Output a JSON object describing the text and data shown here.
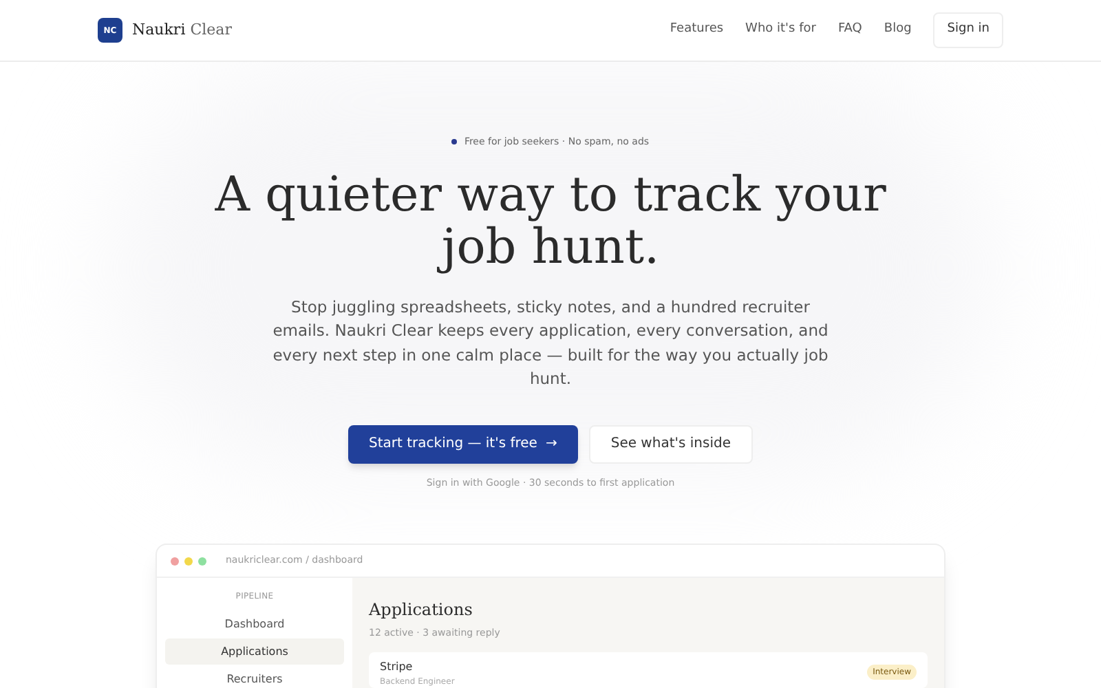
{
  "header": {
    "logo_mark": "NC",
    "brand": {
      "first": "Naukri",
      "second": "Clear"
    },
    "nav": [
      "Features",
      "Who it's for",
      "FAQ",
      "Blog"
    ],
    "sign_in": "Sign in"
  },
  "hero": {
    "badge": "Free for job seekers · No spam, no ads",
    "title": "A quieter way to track your job hunt.",
    "description": "Stop juggling spreadsheets, sticky notes, and a hundred recruiter emails. Naukri Clear keeps every application, every conversation, and every next step in one calm place — built for the way you actually job hunt.",
    "primary_button": "Start tracking — it's free",
    "primary_arrow": "→",
    "secondary_button": "See what's inside",
    "note": "Sign in with Google · 30 seconds to first application"
  },
  "preview": {
    "url": "naukriclear.com / dashboard",
    "sidebar": {
      "section": "PIPELINE",
      "items": [
        {
          "label": "Dashboard",
          "selected": false
        },
        {
          "label": "Applications",
          "selected": true
        },
        {
          "label": "Recruiters",
          "selected": false
        }
      ]
    },
    "title": "Applications",
    "subtitle": "12 active · 3 awaiting reply",
    "rows": [
      {
        "company": "Stripe",
        "role": "Backend Engineer",
        "status": "Interview"
      }
    ]
  }
}
